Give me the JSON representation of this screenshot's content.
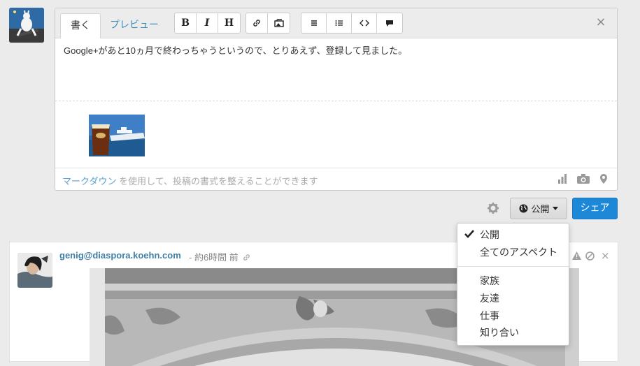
{
  "editor": {
    "tabs": {
      "write": "書く",
      "preview": "プレビュー"
    },
    "toolbar": {
      "bold": "B",
      "italic": "I",
      "heading": "H"
    },
    "text": "Google+があと10ヵ月で終わっちゃうというので、とりあえず、登録して見ました。",
    "close": "×",
    "footer": {
      "markdown_link": "マークダウン",
      "markdown_rest": " を使用して、投稿の書式を整えることができます"
    }
  },
  "publisher": {
    "visibility_label": "公開",
    "share_label": "シェア"
  },
  "aspect_menu": {
    "items": [
      "公開",
      "全てのアスペクト",
      "家族",
      "友達",
      "仕事",
      "知り合い"
    ],
    "selected": "公開"
  },
  "stream_post": {
    "author": "genig@diaspora.koehn.com",
    "time": " - 約6時間 前",
    "hide": "×"
  },
  "colors": {
    "accent": "#1e88d8",
    "link": "#3f8fba",
    "background": "#ebebeb"
  },
  "icons": [
    "bold-icon",
    "italic-icon",
    "heading-icon",
    "link-icon",
    "image-icon",
    "ordered-list-icon",
    "bullet-list-icon",
    "code-icon",
    "quote-icon",
    "close-icon",
    "poll-icon",
    "camera-icon",
    "location-icon",
    "gear-icon",
    "globe-icon",
    "caret-down-icon",
    "check-icon",
    "warning-icon",
    "block-icon",
    "permalink-icon"
  ]
}
